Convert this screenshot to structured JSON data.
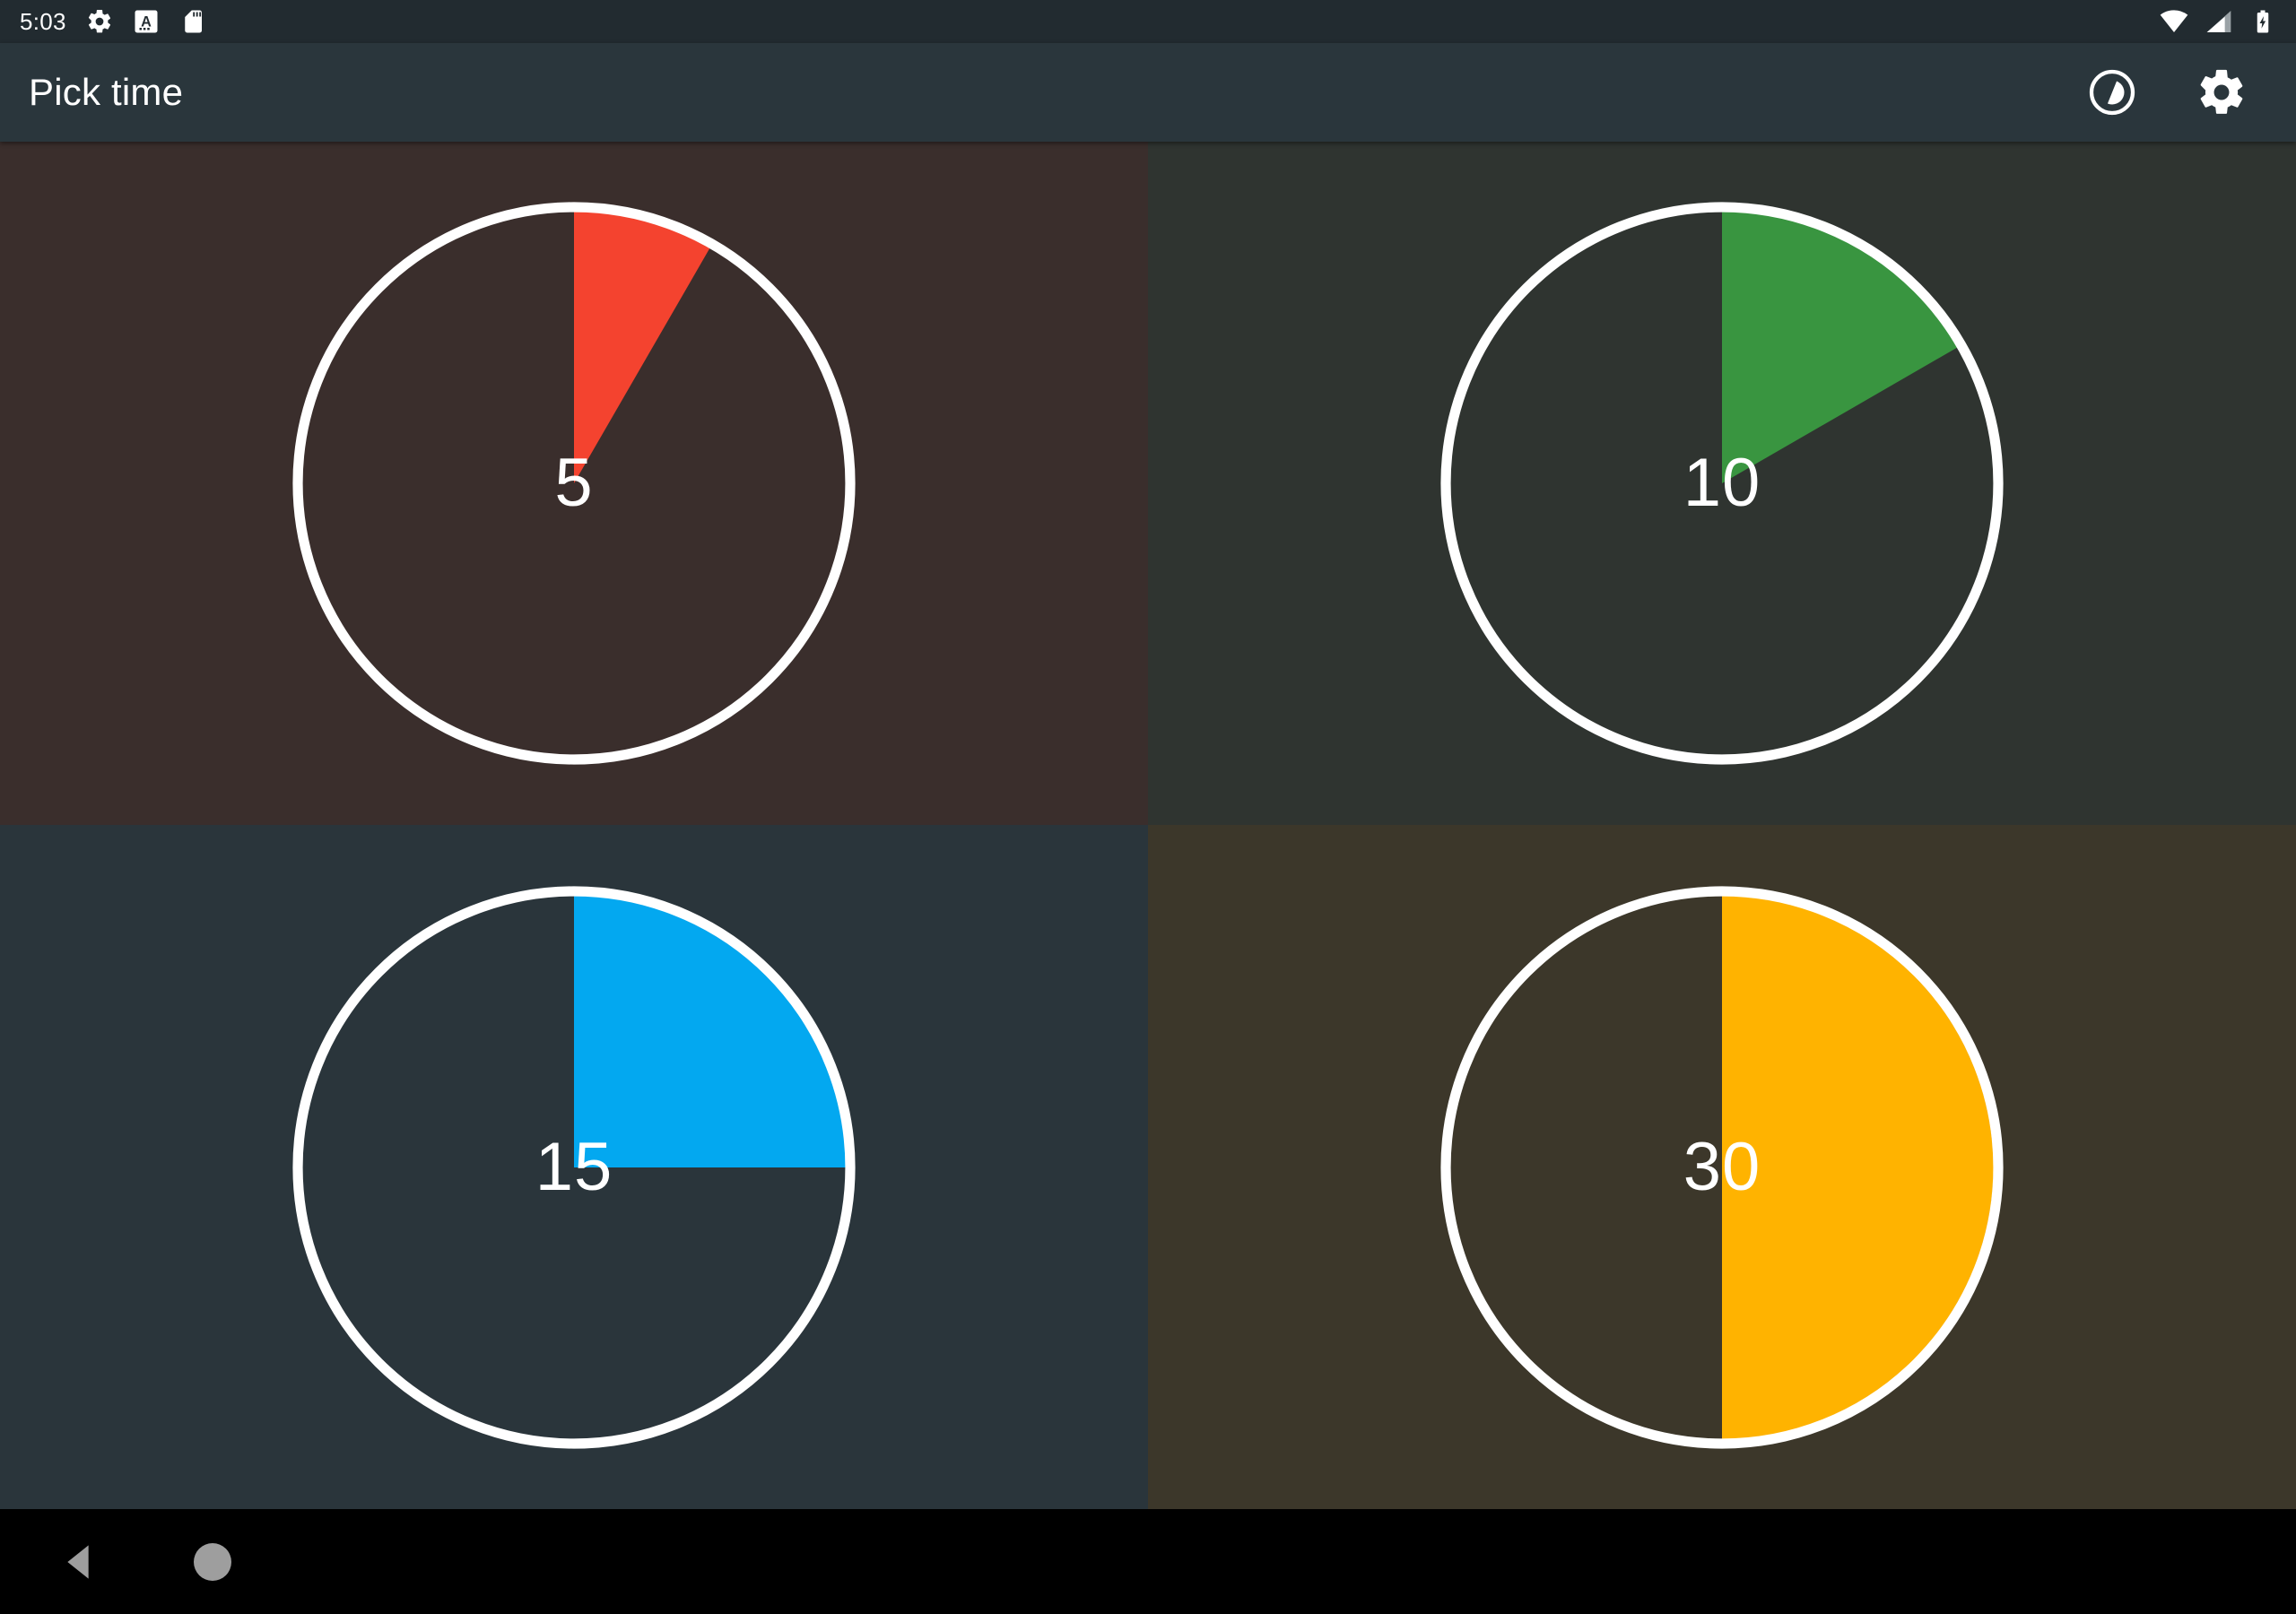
{
  "status_bar": {
    "time": "5:03",
    "left_icons": [
      "gear-icon",
      "a-letter-icon",
      "sd-card-icon"
    ],
    "right_icons": [
      "wifi-icon",
      "cellular-signal-icon",
      "battery-charging-icon"
    ],
    "background_color": "#222b30"
  },
  "toolbar": {
    "title": "Pick time",
    "background_color": "#2a363c",
    "actions": [
      {
        "name": "timer-mode-icon",
        "label": "Timer mode"
      },
      {
        "name": "settings-gear-icon",
        "label": "Settings"
      }
    ]
  },
  "timers": [
    {
      "label": "5",
      "minutes": 5,
      "sweep_degrees": 30,
      "accent_color": "#f4432f",
      "background_color": "#3a2e2c",
      "ring_color": "#ffffff",
      "name": "timer-option-5"
    },
    {
      "label": "10",
      "minutes": 10,
      "sweep_degrees": 60,
      "accent_color": "#399540",
      "background_color": "#2f3430",
      "ring_color": "#ffffff",
      "name": "timer-option-10"
    },
    {
      "label": "15",
      "minutes": 15,
      "sweep_degrees": 90,
      "accent_color": "#03a8f0",
      "background_color": "#2a353b",
      "ring_color": "#ffffff",
      "name": "timer-option-15"
    },
    {
      "label": "30",
      "minutes": 30,
      "sweep_degrees": 180,
      "accent_color": "#ffb300",
      "background_color": "#3c372a",
      "ring_color": "#ffffff",
      "name": "timer-option-30"
    }
  ],
  "nav_bar": {
    "background_color": "#000000",
    "buttons": [
      {
        "name": "nav-back-button",
        "label": "Back"
      },
      {
        "name": "nav-home-button",
        "label": "Home"
      }
    ]
  }
}
